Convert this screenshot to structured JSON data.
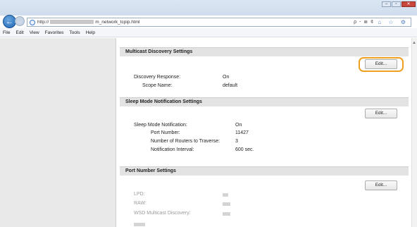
{
  "browser": {
    "url_prefix": "http://",
    "url_suffix": "m_network_tcpip.html",
    "search_glyph": "ρ - ≣ ¢",
    "right_icons": "⌂ ☆ ⚙",
    "window_controls": [
      "–",
      "▫",
      "✕"
    ]
  },
  "menu": [
    "File",
    "Edit",
    "View",
    "Favorites",
    "Tools",
    "Help"
  ],
  "sections": {
    "multicast": {
      "title": "Multicast Discovery Settings",
      "edit_label": "Edit...",
      "rows": [
        {
          "label": "Discovery Response:",
          "value": "On"
        },
        {
          "label": "Scope Name:",
          "value": "default"
        }
      ]
    },
    "sleep": {
      "title": "Sleep Mode Notification Settings",
      "edit_label": "Edit...",
      "rows": [
        {
          "label": "Sleep Mode Notification:",
          "value": "On"
        },
        {
          "label": "Port Number:",
          "value": "11427"
        },
        {
          "label": "Number of Routers to Traverse:",
          "value": "3"
        },
        {
          "label": "Notification Interval:",
          "value": "600 sec."
        }
      ]
    },
    "port": {
      "title": "Port Number Settings",
      "edit_label": "Edit...",
      "rows": [
        {
          "label": "LPD:"
        },
        {
          "label": "RAW:"
        },
        {
          "label": "WSD Multicast Discovery:"
        }
      ]
    }
  },
  "colors": {
    "highlight": "#f0a020",
    "section_header_bg": "#e3e3e3",
    "left_panel_bg": "#e9e9e9"
  }
}
